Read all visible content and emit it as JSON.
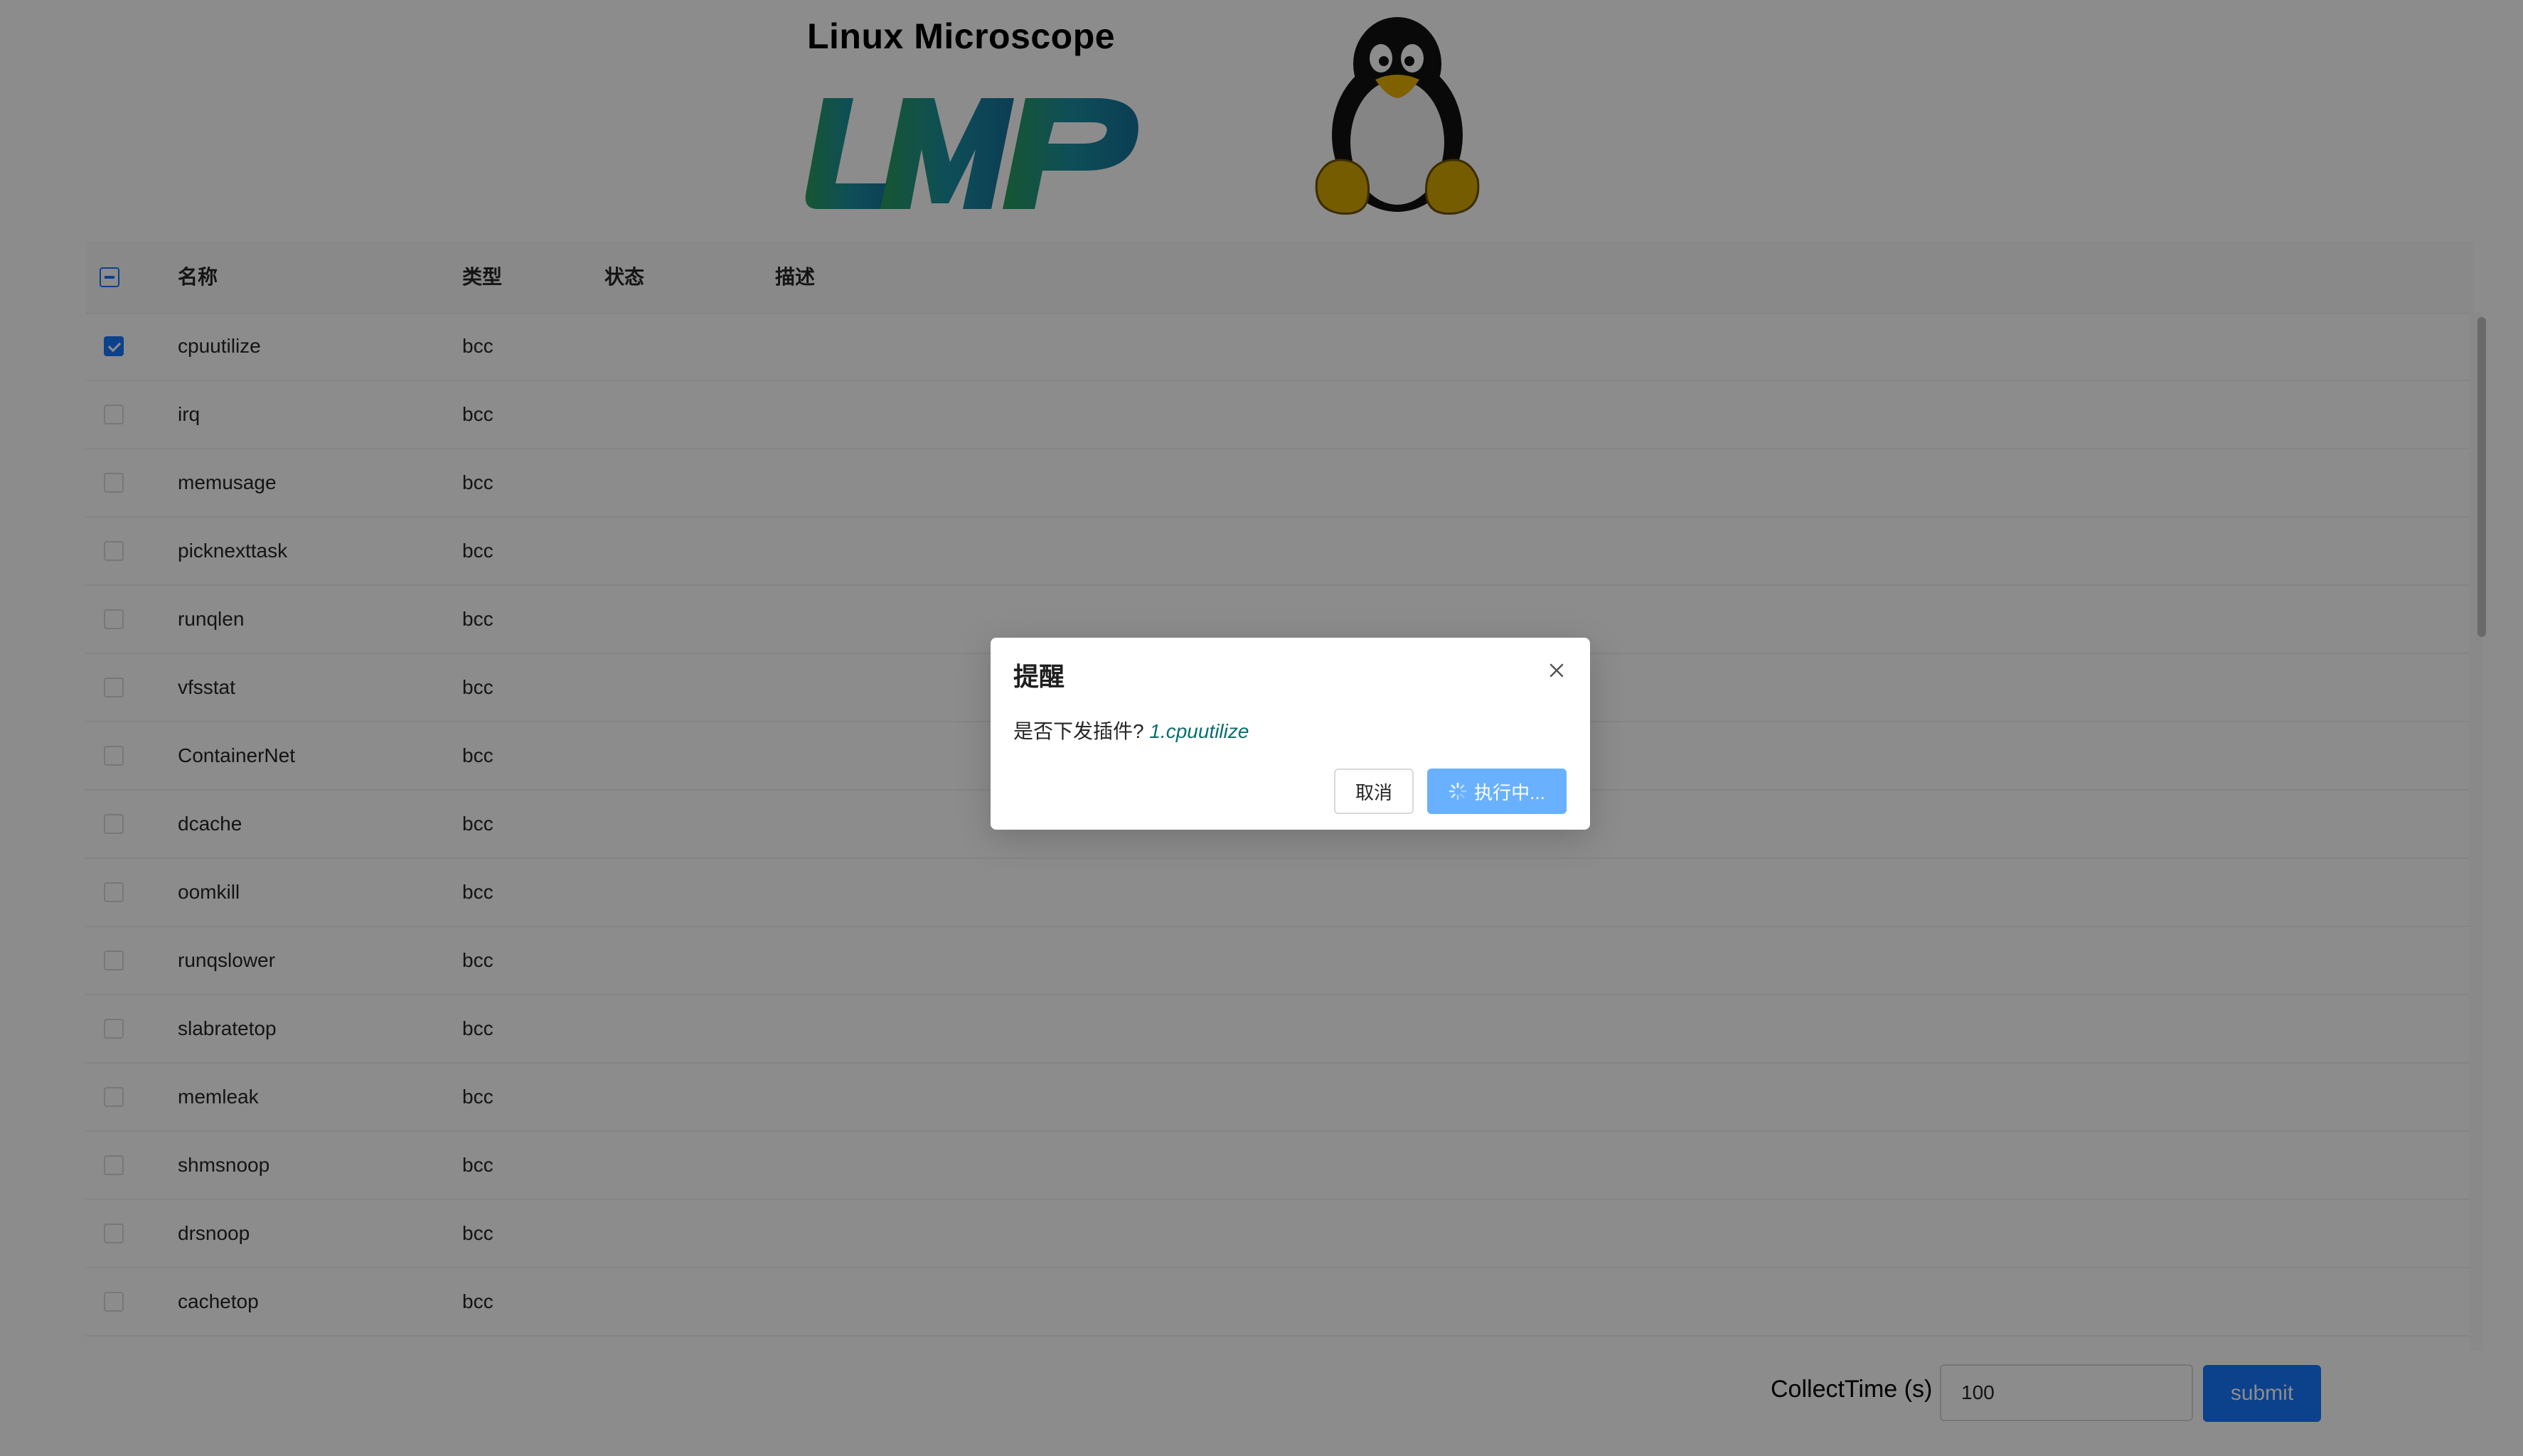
{
  "header": {
    "title": "Linux Microscope"
  },
  "logo": {
    "name": "lmp-logo",
    "colors": [
      "#2a9d5c",
      "#1a8fa0",
      "#16709b"
    ]
  },
  "tux": {
    "name": "tux-penguin"
  },
  "table": {
    "columns": [
      "名称",
      "类型",
      "状态",
      "描述"
    ],
    "header_checkbox": "indeterminate",
    "rows": [
      {
        "name": "cpuutilize",
        "type": "bcc",
        "status": "",
        "desc": "",
        "checked": true
      },
      {
        "name": "irq",
        "type": "bcc",
        "status": "",
        "desc": "",
        "checked": false
      },
      {
        "name": "memusage",
        "type": "bcc",
        "status": "",
        "desc": "",
        "checked": false
      },
      {
        "name": "picknexttask",
        "type": "bcc",
        "status": "",
        "desc": "",
        "checked": false
      },
      {
        "name": "runqlen",
        "type": "bcc",
        "status": "",
        "desc": "",
        "checked": false
      },
      {
        "name": "vfsstat",
        "type": "bcc",
        "status": "",
        "desc": "",
        "checked": false
      },
      {
        "name": "ContainerNet",
        "type": "bcc",
        "status": "",
        "desc": "",
        "checked": false
      },
      {
        "name": "dcache",
        "type": "bcc",
        "status": "",
        "desc": "",
        "checked": false
      },
      {
        "name": "oomkill",
        "type": "bcc",
        "status": "",
        "desc": "",
        "checked": false
      },
      {
        "name": "runqslower",
        "type": "bcc",
        "status": "",
        "desc": "",
        "checked": false
      },
      {
        "name": "slabratetop",
        "type": "bcc",
        "status": "",
        "desc": "",
        "checked": false
      },
      {
        "name": "memleak",
        "type": "bcc",
        "status": "",
        "desc": "",
        "checked": false
      },
      {
        "name": "shmsnoop",
        "type": "bcc",
        "status": "",
        "desc": "",
        "checked": false
      },
      {
        "name": "drsnoop",
        "type": "bcc",
        "status": "",
        "desc": "",
        "checked": false
      },
      {
        "name": "cachetop",
        "type": "bcc",
        "status": "",
        "desc": "",
        "checked": false
      }
    ]
  },
  "form": {
    "collect_label": "CollectTime (s)",
    "collect_value": "100",
    "submit_label": "submit"
  },
  "modal": {
    "title": "提醒",
    "message": "是否下发插件?",
    "plugin": "1.cpuutilize",
    "cancel_label": "取消",
    "ok_label": "执行中..."
  },
  "colors": {
    "primary": "#1677ff",
    "primary_loading": "#69b1ff",
    "mask": "rgba(0,0,0,0.45)"
  }
}
